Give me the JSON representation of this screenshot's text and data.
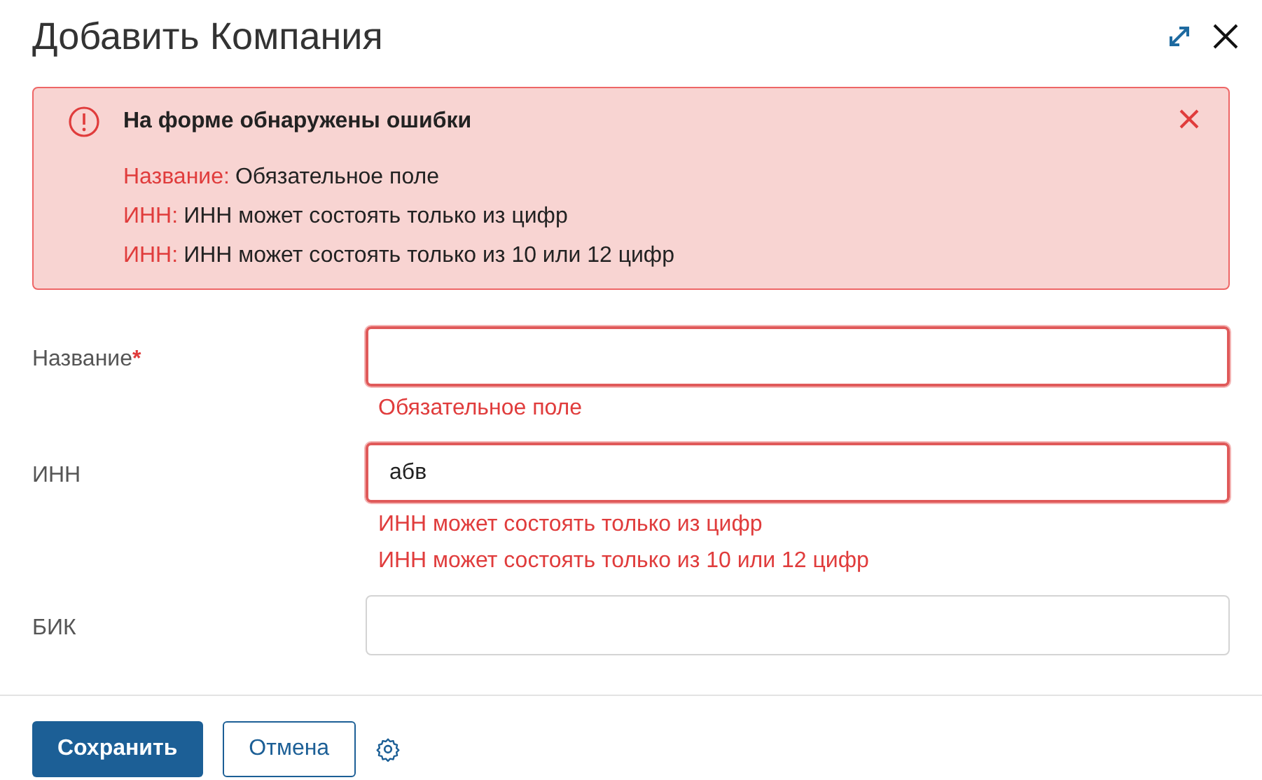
{
  "window": {
    "title": "Добавить Компания"
  },
  "alert": {
    "title": "На форме обнаружены ошибки",
    "errors": [
      {
        "field": "Название:",
        "message": "Обязательное поле"
      },
      {
        "field": "ИНН:",
        "message": "ИНН может состоять только из цифр"
      },
      {
        "field": "ИНН:",
        "message": "ИНН может состоять только из 10 или 12 цифр"
      }
    ]
  },
  "fields": [
    {
      "label": "Название",
      "required_mark": "*",
      "invalid": true,
      "errors": [
        "Обязательное поле"
      ]
    },
    {
      "label": "ИНН",
      "value": "абв",
      "invalid": true,
      "errors": [
        "ИНН может состоять только из цифр",
        "ИНН может состоять только из 10 или 12 цифр"
      ]
    },
    {
      "label": "БИК",
      "invalid": false
    }
  ],
  "buttons": [
    {
      "kind": "primary",
      "label": "Сохранить"
    },
    {
      "kind": "secondary",
      "label": "Отмена"
    }
  ]
}
